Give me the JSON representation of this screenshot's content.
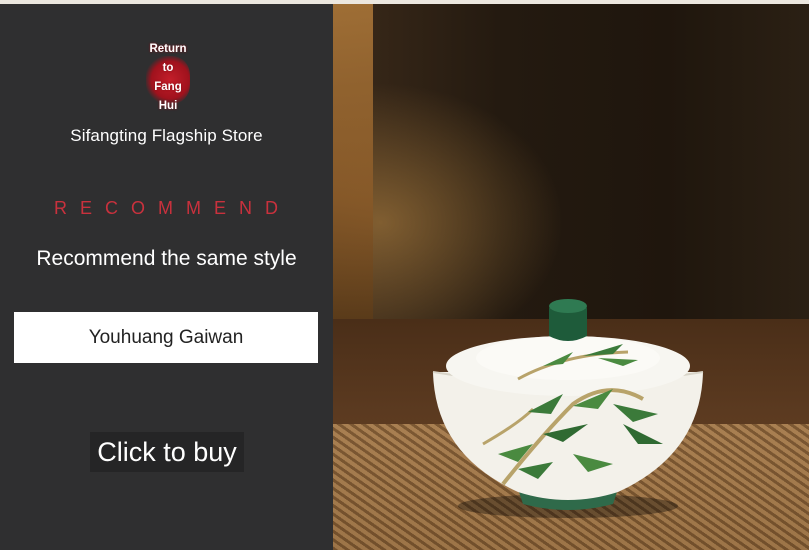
{
  "store": {
    "logo_lines": [
      "Return",
      "to",
      "Fang",
      "Hui"
    ],
    "name": "Sifangting Flagship Store"
  },
  "recommend": {
    "heading": "RECOMMEND",
    "subheading": "Recommend the same style"
  },
  "product": {
    "name": "Youhuang Gaiwan"
  },
  "actions": {
    "buy_label": "Click to buy"
  },
  "colors": {
    "panel_bg": "#2f2f30",
    "accent_red": "#c9313d",
    "lid_knob_green": "#1e5b3a"
  }
}
